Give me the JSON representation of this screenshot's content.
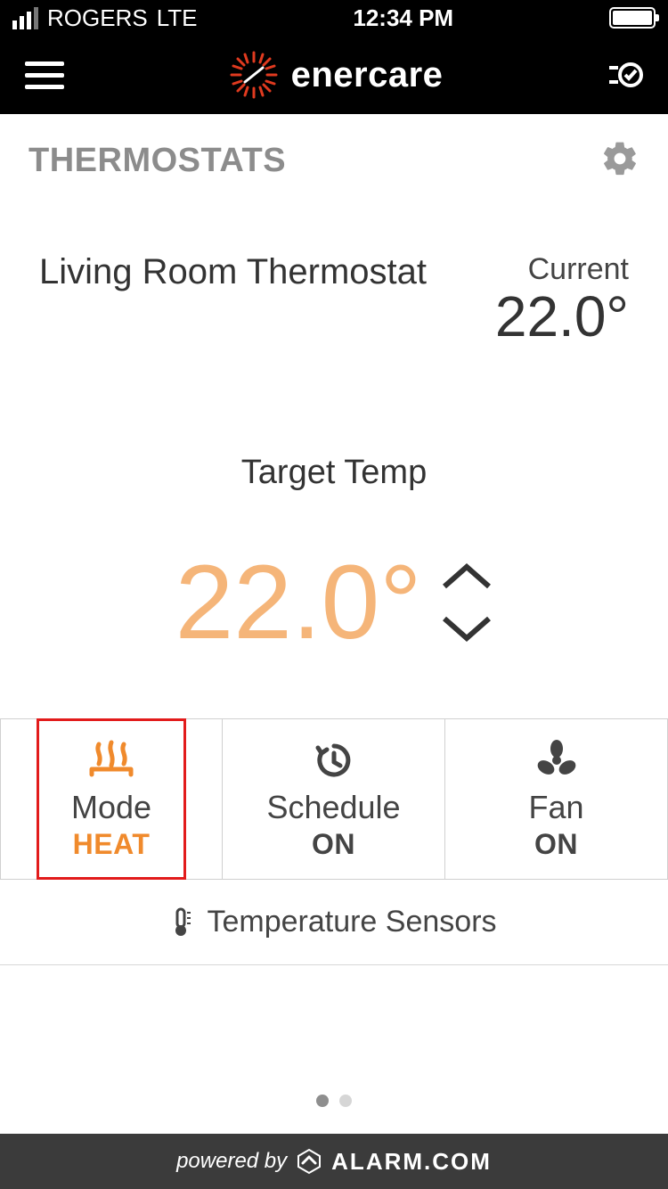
{
  "status": {
    "carrier": "ROGERS",
    "network": "LTE",
    "time": "12:34 PM"
  },
  "header": {
    "brand": "enercare"
  },
  "section": {
    "title": "THERMOSTATS"
  },
  "device": {
    "name": "Living Room Thermostat",
    "current_label": "Current",
    "current_value": "22.0°"
  },
  "target": {
    "label": "Target Temp",
    "value": "22.0°"
  },
  "controls": {
    "mode": {
      "title": "Mode",
      "value": "HEAT"
    },
    "schedule": {
      "title": "Schedule",
      "value": "ON"
    },
    "fan": {
      "title": "Fan",
      "value": "ON"
    }
  },
  "sensors": {
    "label": "Temperature Sensors"
  },
  "footer": {
    "powered_by": "powered by",
    "brand": "ALARM.COM"
  },
  "colors": {
    "accent_orange": "#f08a2c",
    "target_orange": "#f5b579",
    "highlight_red": "#e21b1b"
  }
}
